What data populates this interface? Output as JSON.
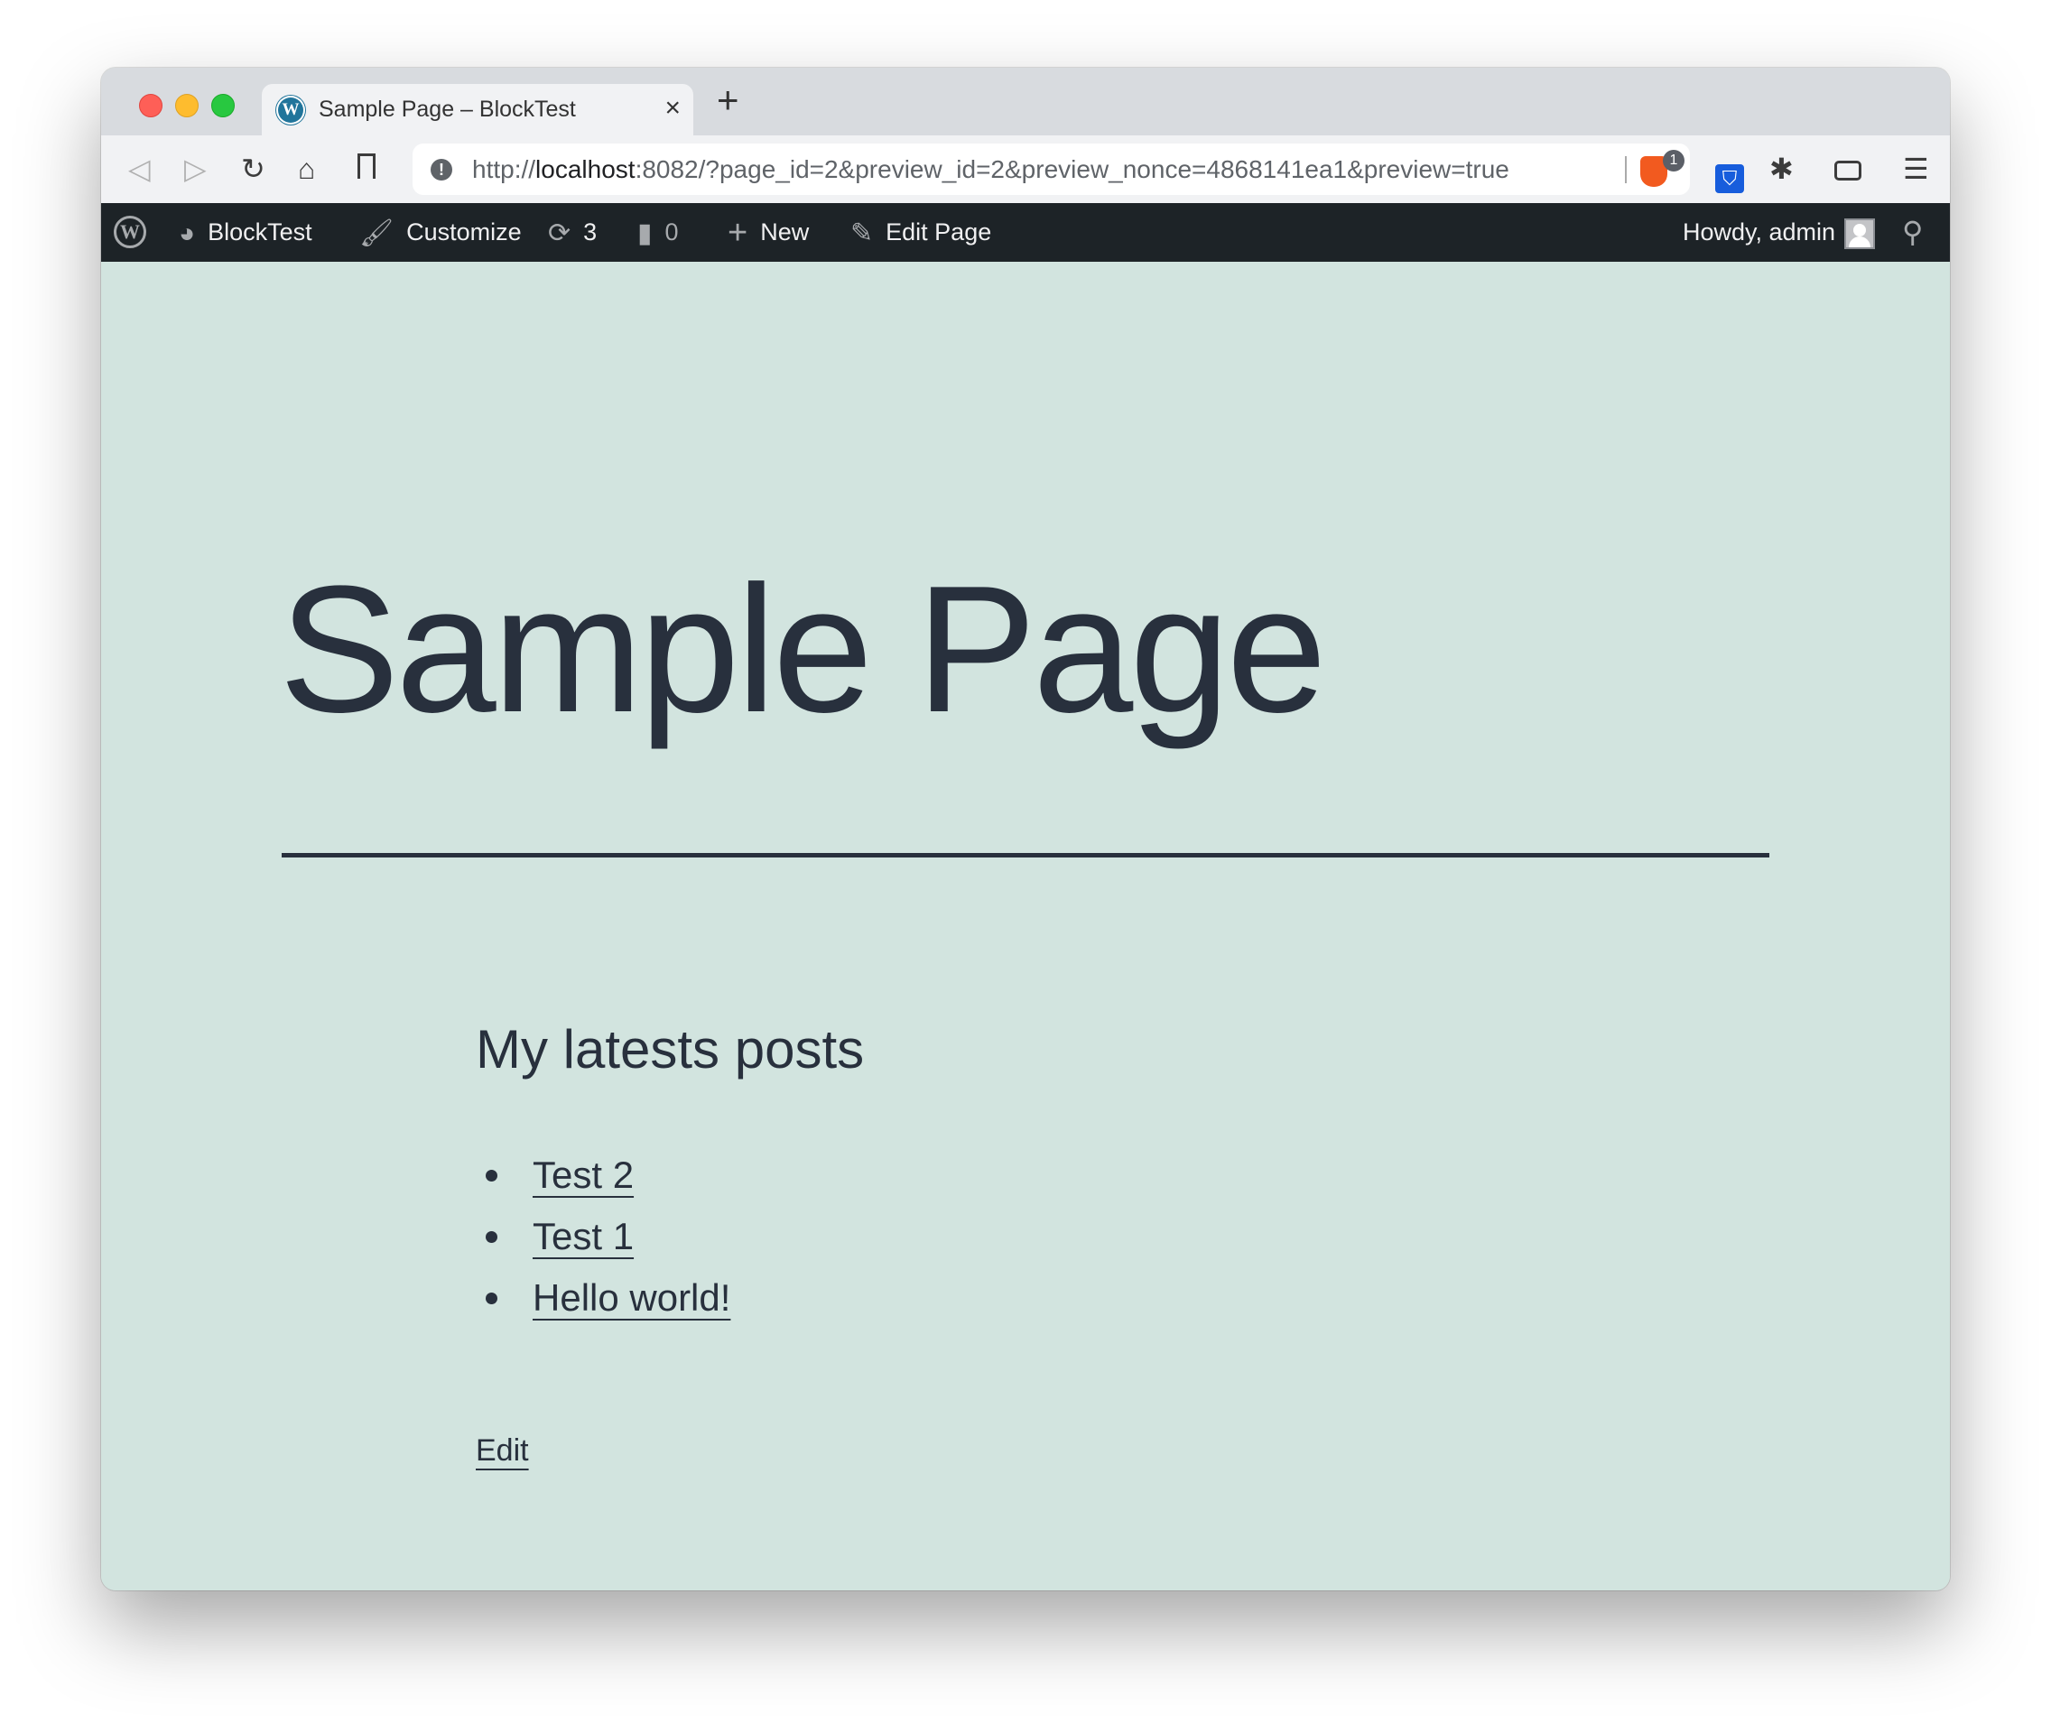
{
  "browser": {
    "tab": {
      "title": "Sample Page – BlockTest",
      "favicon": "wordpress-icon",
      "close": "×"
    },
    "new_tab": "+",
    "toolbar": {
      "back": "◁",
      "forward": "▷",
      "reload": "↻",
      "home": "⌂",
      "bookmark": "🔖",
      "url_prefix": "http://",
      "url_host": "localhost",
      "url_rest": ":8082/?page_id=2&preview_id=2&preview_nonce=4868141ea1&preview=true",
      "security_icon": "!",
      "brave_badge": "1",
      "extensions_icon": "✱",
      "menu_icon": "☰"
    }
  },
  "adminbar": {
    "wp_logo": "W",
    "site_name": "BlockTest",
    "customize": "Customize",
    "updates_count": "3",
    "comments_count": "0",
    "new_label": "New",
    "edit_page": "Edit Page",
    "howdy": "Howdy, admin"
  },
  "page": {
    "title": "Sample Page",
    "posts_heading": "My latests posts",
    "posts": [
      {
        "label": "Test 2"
      },
      {
        "label": "Test 1"
      },
      {
        "label": "Hello world!"
      }
    ],
    "edit_link": "Edit"
  },
  "colors": {
    "background": "#d2e4df",
    "text": "#28303d",
    "adminbar": "#1d2327"
  }
}
